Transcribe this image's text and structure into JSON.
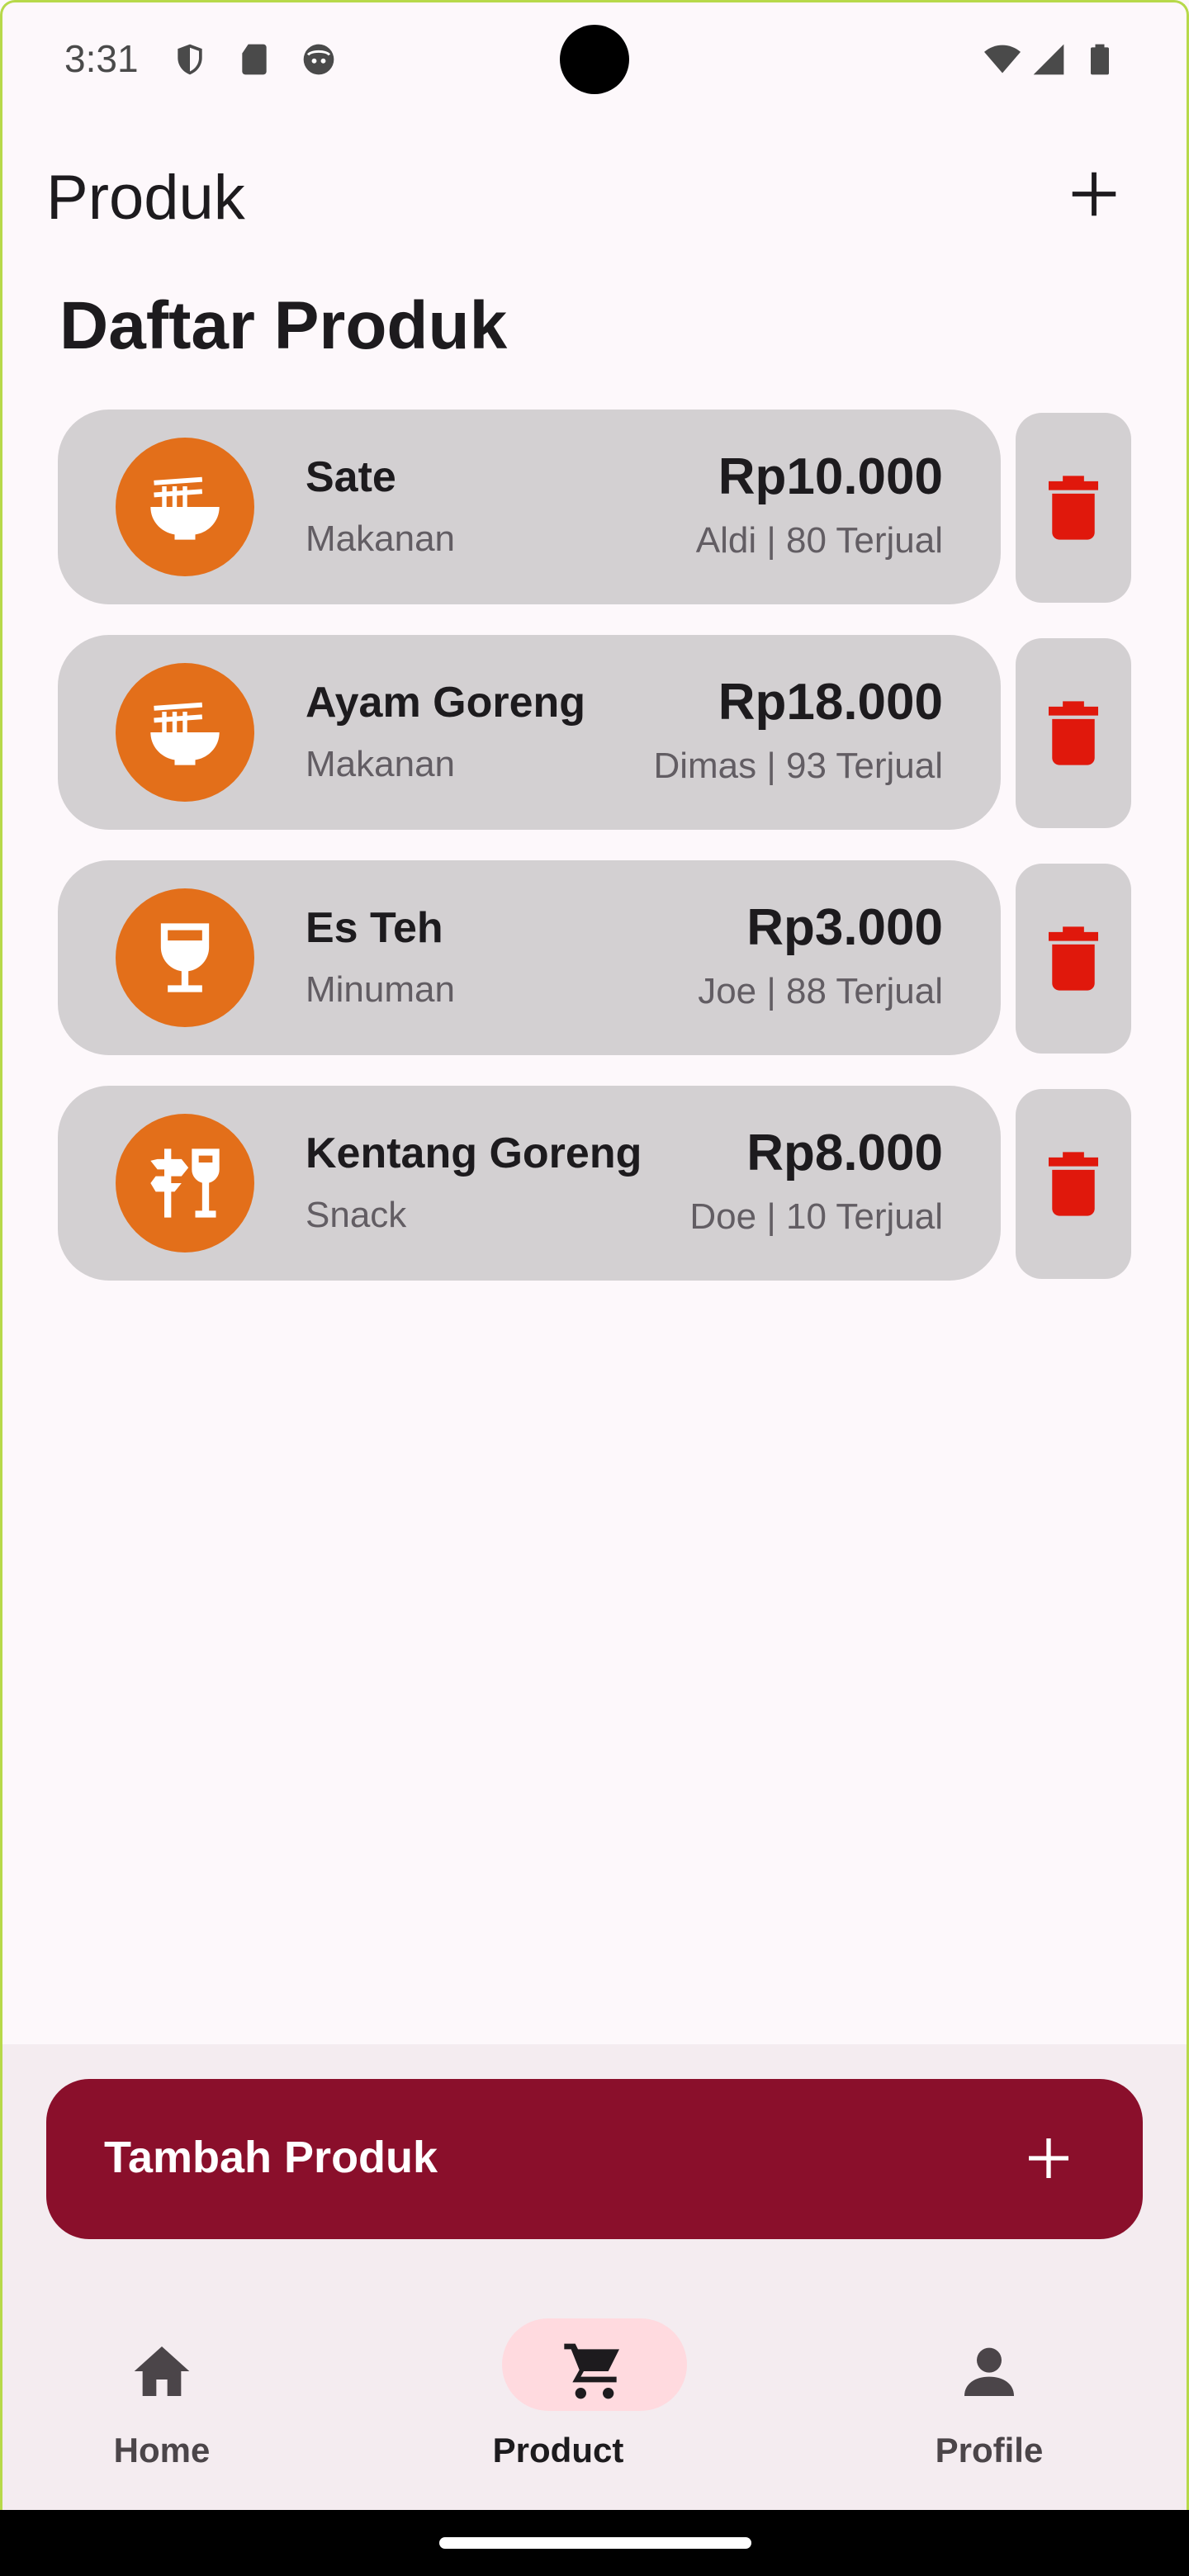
{
  "status_bar": {
    "time": "3:31",
    "icons": [
      "shield-icon",
      "sd-card-icon",
      "face-icon",
      "wifi-icon",
      "signal-icon",
      "battery-icon"
    ]
  },
  "app_bar": {
    "title": "Produk",
    "action_icon": "add-icon"
  },
  "section_title": "Daftar Produk",
  "products": [
    {
      "name": "Sate",
      "category": "Makanan",
      "price": "Rp10.000",
      "meta": "Aldi | 80 Terjual",
      "icon": "noodle-bowl-icon"
    },
    {
      "name": "Ayam Goreng",
      "category": "Makanan",
      "price": "Rp18.000",
      "meta": "Dimas | 93 Terjual",
      "icon": "noodle-bowl-icon"
    },
    {
      "name": "Es Teh",
      "category": "Minuman",
      "price": "Rp3.000",
      "meta": "Joe | 88 Terjual",
      "icon": "wine-glass-icon"
    },
    {
      "name": "Kentang Goreng",
      "category": "Snack",
      "price": "Rp8.000",
      "meta": "Doe | 10 Terjual",
      "icon": "food-sign-icon"
    }
  ],
  "add_product_button": {
    "label": "Tambah Produk",
    "icon": "add-icon"
  },
  "bottom_nav": {
    "items": [
      {
        "label": "Home",
        "icon": "home-icon",
        "active": false
      },
      {
        "label": "Product",
        "icon": "cart-icon",
        "active": true
      },
      {
        "label": "Profile",
        "icon": "person-icon",
        "active": false
      }
    ]
  },
  "colors": {
    "accent": "#8a0f2b",
    "avatar": "#e36f1a",
    "delete": "#e0180c",
    "card": "#d3d0d2",
    "nav_active_pill": "#ffdadf"
  }
}
